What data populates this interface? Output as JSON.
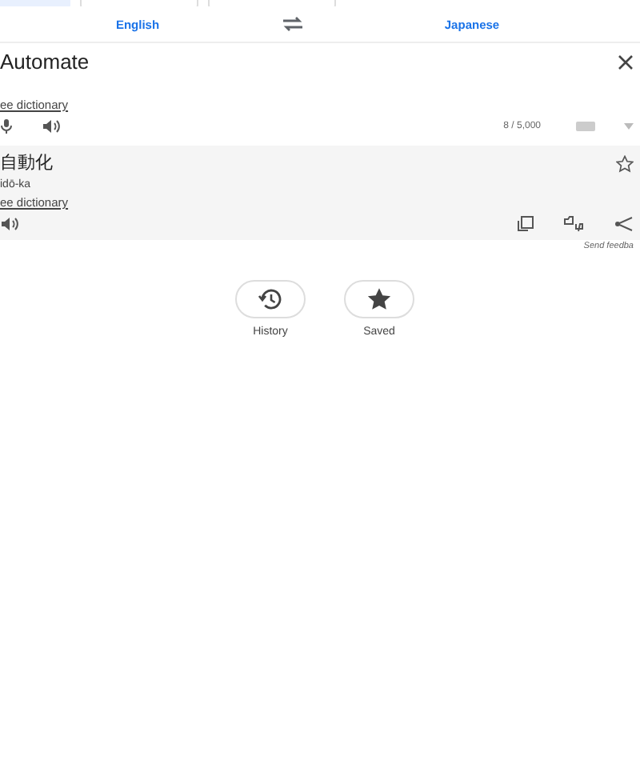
{
  "top_tabs": [
    {
      "selected": true
    },
    {
      "selected": false
    },
    {
      "selected": false
    }
  ],
  "languages": {
    "source": "English",
    "target": "Japanese"
  },
  "input": {
    "text": "Automate",
    "dictionary_link": "ee dictionary",
    "char_count": "8 / 5,000"
  },
  "output": {
    "text": "自動化",
    "romanization": "idō-ka",
    "dictionary_link": "ee dictionary",
    "starred": false
  },
  "feedback": "Send feedba",
  "shortcuts": [
    {
      "kind": "history",
      "label": "History"
    },
    {
      "kind": "saved",
      "label": "Saved"
    }
  ]
}
